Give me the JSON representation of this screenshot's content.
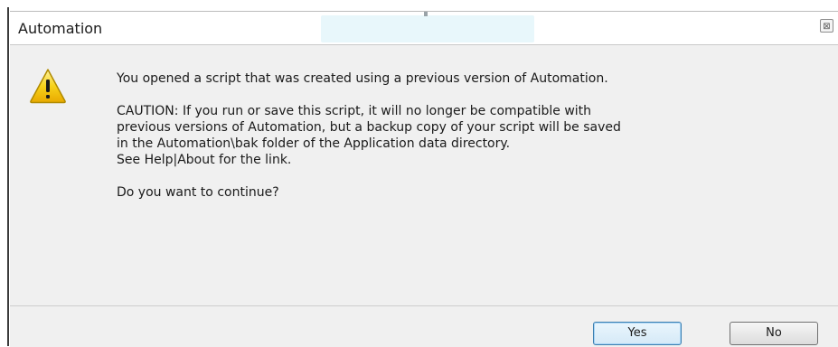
{
  "dialog": {
    "title": "Automation",
    "close_glyph": "⊠",
    "icon": "warning-icon",
    "message": {
      "primary": "You opened a script that was created using a previous version of Automation.",
      "caution_lines": [
        "CAUTION:  If you run or save this script, it will no longer be compatible with",
        "previous versions of Automation, but a backup copy of your script will be saved",
        "in the Automation\\bak folder of the Application data directory.",
        "See Help|About for the link."
      ],
      "question": "Do you want to continue?"
    },
    "buttons": {
      "yes": "Yes",
      "no": "No"
    }
  },
  "colors": {
    "warning_yellow": "#f7d21a",
    "warning_outline": "#b08a00",
    "content_bg": "#f0f0f0",
    "default_button_border": "#3c7fb1"
  }
}
